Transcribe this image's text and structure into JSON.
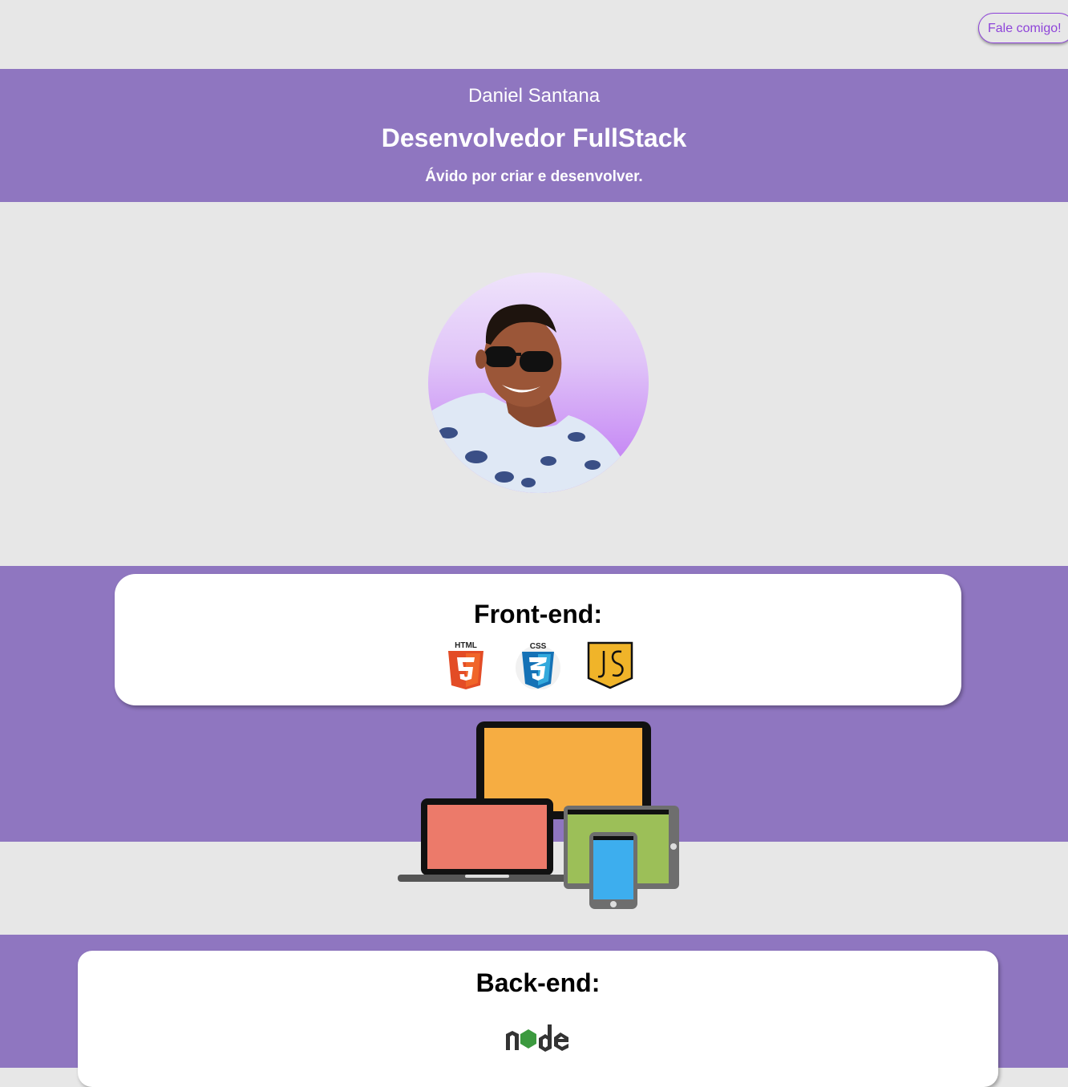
{
  "header": {
    "contact_label": "Fale comigo!"
  },
  "hero": {
    "name": "Daniel Santana",
    "role": "Desenvolvedor FullStack",
    "tagline": "Ávido por criar e desenvolver."
  },
  "frontend": {
    "title": "Front-end:",
    "icons": [
      {
        "name": "html5-icon",
        "label": "HTML",
        "color": "#e34c26"
      },
      {
        "name": "css3-icon",
        "label": "CSS",
        "color": "#2965f1"
      },
      {
        "name": "javascript-icon",
        "label": "JS",
        "color": "#f0b429"
      }
    ]
  },
  "backend": {
    "title": "Back-end:",
    "icons": [
      {
        "name": "nodejs-icon",
        "label": "node"
      }
    ]
  },
  "colors": {
    "page_bg": "#e7e7e7",
    "purple_band": "#8f76c0",
    "accent": "#8e44d9",
    "card": "#ffffff"
  }
}
